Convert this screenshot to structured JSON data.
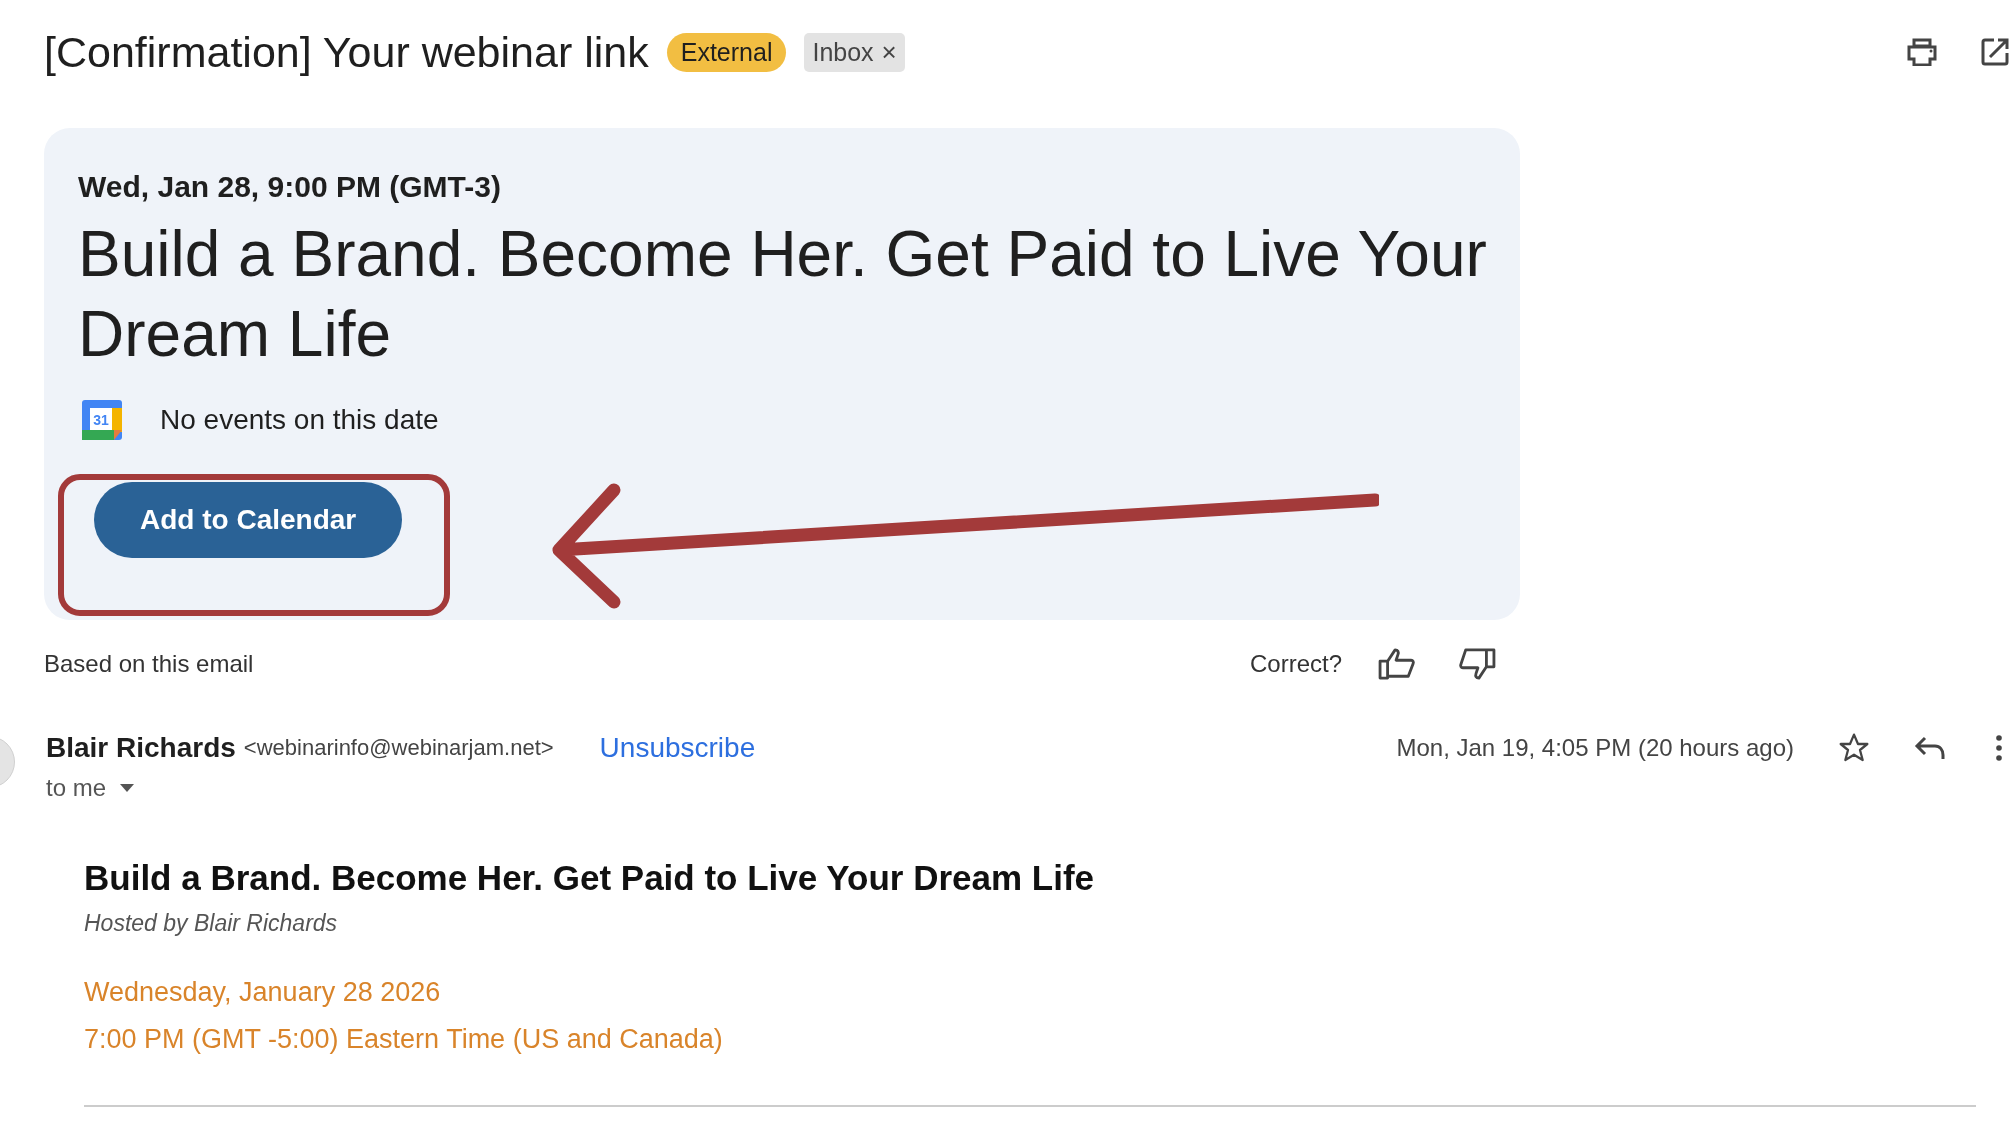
{
  "subject": {
    "title": "[Confirmation] Your webinar link",
    "labels": [
      {
        "text": "External",
        "kind": "warning"
      },
      {
        "text": "Inbox",
        "kind": "removable",
        "remove": "×"
      }
    ]
  },
  "event_card": {
    "datetime": "Wed, Jan 28, 9:00 PM (GMT-3)",
    "headline": "Build a Brand. Become Her. Get Paid to Live Your Dream Life",
    "calendar_status": "No events on this date",
    "button": "Add to Calendar",
    "calendar_date": "31"
  },
  "feedback": {
    "source": "Based on this email",
    "question": "Correct?"
  },
  "message": {
    "sender": "Blair Richards",
    "email": "<webinarinfo@webinarjam.net>",
    "unsubscribe": "Unsubscribe",
    "date": "Mon, Jan 19, 4:05 PM (20 hours ago)",
    "recipient": "to me",
    "starred": false
  },
  "body": {
    "title": "Build a Brand. Become Her. Get Paid to Live Your Dream Life",
    "host": "Hosted by Blair Richards",
    "date": "Wednesday, January 28 2026",
    "time": "7:00 PM (GMT -5:00) Eastern Time (US and Canada)"
  }
}
